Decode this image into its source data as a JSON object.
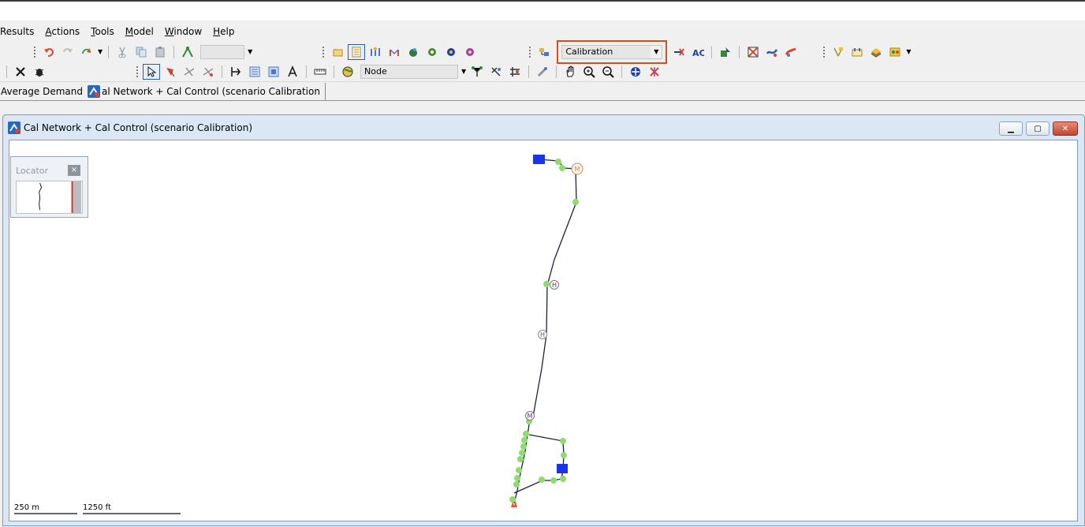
{
  "menubar": {
    "items": [
      {
        "label": "Results",
        "name": "menu-results"
      },
      {
        "label": "Actions",
        "name": "menu-actions"
      },
      {
        "label": "Tools",
        "name": "menu-tools"
      },
      {
        "label": "Model",
        "name": "menu-model"
      },
      {
        "label": "Window",
        "name": "menu-window"
      },
      {
        "label": "Help",
        "name": "menu-help"
      }
    ]
  },
  "toolbar": {
    "scenario_combo_value": "Calibration",
    "element_combo_value": "Node",
    "empty_combo_value": ""
  },
  "doctabs": {
    "tab1_label": "Average Demand",
    "tab2_label": "al Network + Cal Control (scenario Calibration"
  },
  "mdi_window": {
    "title": "Cal Network + Cal Control (scenario Calibration)"
  },
  "locator": {
    "title": "Locator",
    "close": "×"
  },
  "scale": {
    "metric_label": "250 m",
    "imperial_label": "1250 ft"
  },
  "colors": {
    "highlight_border": "#d2501e",
    "junction": "#8fdc6e",
    "tank": "#1a35e6",
    "pipe": "#1c2340"
  }
}
